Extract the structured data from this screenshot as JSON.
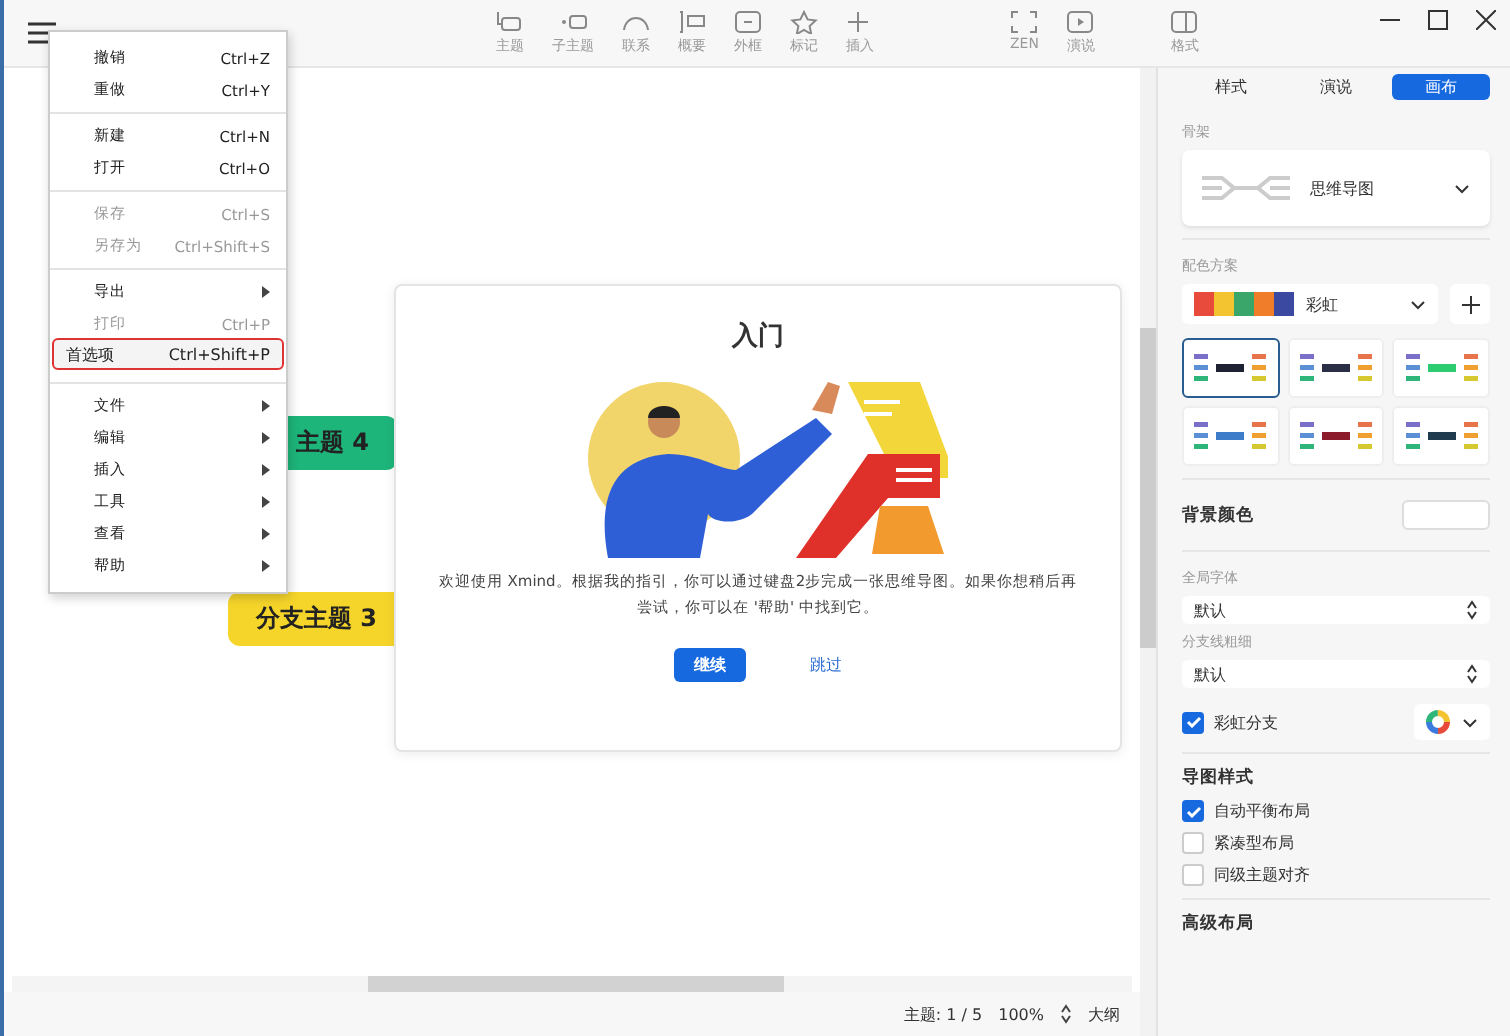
{
  "toolbar": [
    {
      "label": "主题",
      "kind": "topic"
    },
    {
      "label": "子主题",
      "kind": "subtopic"
    },
    {
      "label": "联系",
      "kind": "relation"
    },
    {
      "label": "概要",
      "kind": "summary"
    },
    {
      "label": "外框",
      "kind": "boundary"
    },
    {
      "label": "标记",
      "kind": "marker"
    },
    {
      "label": "插入",
      "kind": "insert"
    },
    {
      "label": "ZEN",
      "kind": "zen"
    },
    {
      "label": "演说",
      "kind": "pitch"
    },
    {
      "label": "格式",
      "kind": "format"
    }
  ],
  "menu": {
    "groups": [
      [
        {
          "label": "撤销",
          "shortcut": "Ctrl+Z",
          "disabled": false,
          "submenu": false,
          "selected": false
        },
        {
          "label": "重做",
          "shortcut": "Ctrl+Y",
          "disabled": false,
          "submenu": false,
          "selected": false
        }
      ],
      [
        {
          "label": "新建",
          "shortcut": "Ctrl+N",
          "disabled": false,
          "submenu": false,
          "selected": false
        },
        {
          "label": "打开",
          "shortcut": "Ctrl+O",
          "disabled": false,
          "submenu": false,
          "selected": false
        }
      ],
      [
        {
          "label": "保存",
          "shortcut": "Ctrl+S",
          "disabled": true,
          "submenu": false,
          "selected": false
        },
        {
          "label": "另存为",
          "shortcut": "Ctrl+Shift+S",
          "disabled": true,
          "submenu": false,
          "selected": false
        }
      ],
      [
        {
          "label": "导出",
          "disabled": false,
          "submenu": true,
          "selected": false
        },
        {
          "label": "打印",
          "shortcut": "Ctrl+P",
          "disabled": true,
          "submenu": false,
          "selected": false
        },
        {
          "label": "首选项",
          "shortcut": "Ctrl+Shift+P",
          "disabled": false,
          "submenu": false,
          "selected": true
        }
      ],
      [
        {
          "label": "文件",
          "disabled": false,
          "submenu": true,
          "selected": false
        },
        {
          "label": "编辑",
          "disabled": false,
          "submenu": true,
          "selected": false
        },
        {
          "label": "插入",
          "disabled": false,
          "submenu": true,
          "selected": false
        },
        {
          "label": "工具",
          "disabled": false,
          "submenu": true,
          "selected": false
        },
        {
          "label": "查看",
          "disabled": false,
          "submenu": true,
          "selected": false
        },
        {
          "label": "帮助",
          "disabled": false,
          "submenu": true,
          "selected": false
        }
      ]
    ]
  },
  "canvas": {
    "nodes": [
      {
        "text": "主题 4",
        "color": "#1db57a"
      },
      {
        "text": "分支主题 3",
        "color": "#f6d52a"
      }
    ]
  },
  "dialog": {
    "title": "入门",
    "message": "欢迎使用 Xmind。根据我的指引，你可以通过键盘2步完成一张思维导图。如果你想稍后再尝试，你可以在 '帮助' 中找到它。",
    "primary_button": "继续",
    "link": "跳过"
  },
  "panel": {
    "tabs": [
      {
        "label": "样式",
        "selected": false
      },
      {
        "label": "演说",
        "selected": false
      },
      {
        "label": "画布",
        "selected": true
      }
    ],
    "skeleton": {
      "label": "骨架",
      "value": "思维导图"
    },
    "color_scheme": {
      "label": "配色方案",
      "value": "彩虹",
      "themes": [
        {
          "color": "#1e2233",
          "selected": true
        },
        {
          "color": "#2a2f45",
          "selected": false
        },
        {
          "color": "#2ecc71",
          "selected": false
        },
        {
          "color": "#3d7cc9",
          "selected": false
        },
        {
          "color": "#8b1a2b",
          "selected": false
        },
        {
          "color": "#1f3b4d",
          "selected": false
        }
      ]
    },
    "background": {
      "label": "背景颜色"
    },
    "font": {
      "label": "全局字体",
      "value": "默认"
    },
    "branch_width": {
      "label": "分支线粗细",
      "value": "默认"
    },
    "rainbow_branch": {
      "label": "彩虹分支",
      "checked": true
    },
    "map_style": {
      "title": "导图样式",
      "options": [
        {
          "label": "自动平衡布局",
          "checked": true
        },
        {
          "label": "紧凑型布局",
          "checked": false
        },
        {
          "label": "同级主题对齐",
          "checked": false
        }
      ]
    },
    "advanced": {
      "title": "高级布局"
    }
  },
  "status_bar": {
    "topics": "主题: 1 / 5",
    "zoom": "100%",
    "view": "大纲"
  }
}
